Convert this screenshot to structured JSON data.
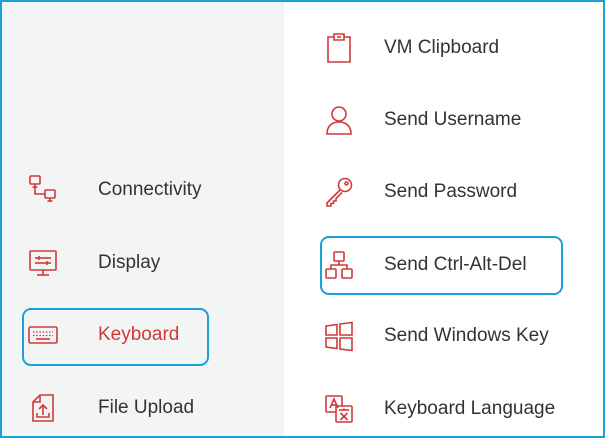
{
  "colors": {
    "accent": "#d0393c",
    "highlight": "#1ba0d8",
    "left_background": "#f3f4f4",
    "text": "#333333"
  },
  "left_menu": {
    "items": [
      {
        "label": "Connectivity",
        "icon": "connectivity-icon",
        "active": false
      },
      {
        "label": "Display",
        "icon": "display-icon",
        "active": false
      },
      {
        "label": "Keyboard",
        "icon": "keyboard-icon",
        "active": true
      },
      {
        "label": "File Upload",
        "icon": "file-upload-icon",
        "active": false
      }
    ]
  },
  "right_menu": {
    "items": [
      {
        "label": "VM Clipboard",
        "icon": "clipboard-icon"
      },
      {
        "label": "Send Username",
        "icon": "user-icon"
      },
      {
        "label": "Send Password",
        "icon": "key-icon"
      },
      {
        "label": "Send Ctrl-Alt-Del",
        "icon": "ctrl-alt-del-icon"
      },
      {
        "label": "Send Windows Key",
        "icon": "windows-key-icon"
      },
      {
        "label": "Keyboard Language",
        "icon": "keyboard-language-icon"
      }
    ]
  }
}
